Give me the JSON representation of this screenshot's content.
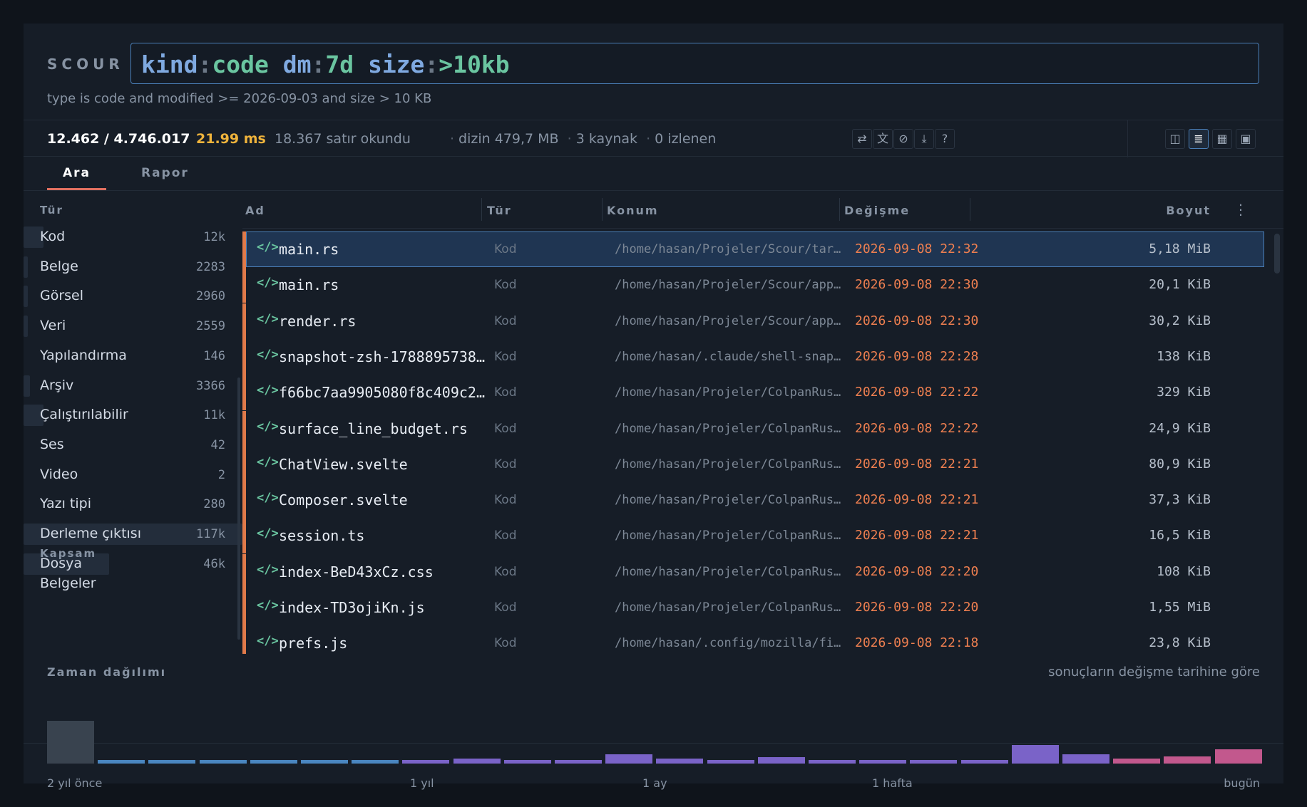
{
  "header": {
    "brand": "SCOUR",
    "query": [
      {
        "t": "kind",
        "c": "key"
      },
      {
        "t": ":",
        "c": "colon"
      },
      {
        "t": "code",
        "c": "val"
      },
      {
        "t": " dm",
        "c": "key"
      },
      {
        "t": ":",
        "c": "colon"
      },
      {
        "t": "7d",
        "c": "val"
      },
      {
        "t": " size",
        "c": "key"
      },
      {
        "t": ":",
        "c": "colon"
      },
      {
        "t": ">10kb",
        "c": "val"
      }
    ],
    "explain": "type is code and modified >= 2026-09-03 and size > 10 KB"
  },
  "stats": {
    "count": "12.462 / 4.746.017",
    "ms": "21.99 ms",
    "rows_read": "18.367 satır okundu",
    "index": "dizin 479,7 MB",
    "sources": "3 kaynak",
    "watched": "0 izlenen"
  },
  "toolbar": {
    "actions": [
      {
        "name": "swap-icon",
        "glyph": "⇄"
      },
      {
        "name": "translate-icon",
        "glyph": "文"
      },
      {
        "name": "block-icon",
        "glyph": "⊘"
      },
      {
        "name": "download-icon",
        "glyph": "⤓"
      },
      {
        "name": "help-icon",
        "glyph": "?"
      }
    ],
    "views": [
      {
        "name": "split-view-icon",
        "glyph": "◫",
        "active": false
      },
      {
        "name": "list-view-icon",
        "glyph": "≣",
        "active": true
      },
      {
        "name": "grid-view-icon",
        "glyph": "▦",
        "active": false
      },
      {
        "name": "preview-view-icon",
        "glyph": "▣",
        "active": false
      }
    ]
  },
  "tabs": {
    "search": "Ara",
    "report": "Rapor"
  },
  "sidebar": {
    "type_heading": "Tür",
    "facets": [
      {
        "label": "Kod",
        "count": "12k",
        "fill": 0.09
      },
      {
        "label": "Belge",
        "count": "2283",
        "fill": 0.02
      },
      {
        "label": "Görsel",
        "count": "2960",
        "fill": 0.02
      },
      {
        "label": "Veri",
        "count": "2559",
        "fill": 0.02
      },
      {
        "label": "Yapılandırma",
        "count": "146",
        "fill": 0.0
      },
      {
        "label": "Arşiv",
        "count": "3366",
        "fill": 0.03
      },
      {
        "label": "Çalıştırılabilir",
        "count": "11k",
        "fill": 0.09
      },
      {
        "label": "Ses",
        "count": "42",
        "fill": 0.0
      },
      {
        "label": "Video",
        "count": "2",
        "fill": 0.0
      },
      {
        "label": "Yazı tipi",
        "count": "280",
        "fill": 0.0
      },
      {
        "label": "Derleme çıktısı",
        "count": "117k",
        "fill": 1.0
      },
      {
        "label": "Dosya",
        "count": "46k",
        "fill": 0.39
      }
    ],
    "scope_heading": "Kapsam",
    "scope_item": "Belgeler"
  },
  "table": {
    "columns": {
      "name": "Ad",
      "type": "Tür",
      "location": "Konum",
      "modified": "Değişme",
      "size": "Boyut"
    },
    "icon_glyph": "</>",
    "rows": [
      {
        "name": "main.rs",
        "type": "Kod",
        "path": "/home/hasan/Projeler/Scour/targ…",
        "date": "2026-09-08 22:32",
        "size": "5,18 MiB"
      },
      {
        "name": "main.rs",
        "type": "Kod",
        "path": "/home/hasan/Projeler/Scour/apps…",
        "date": "2026-09-08 22:30",
        "size": "20,1 KiB"
      },
      {
        "name": "render.rs",
        "type": "Kod",
        "path": "/home/hasan/Projeler/Scour/apps…",
        "date": "2026-09-08 22:30",
        "size": "30,2 KiB"
      },
      {
        "name": "snapshot-zsh-1788895738…",
        "type": "Kod",
        "path": "/home/hasan/.claude/shell-snaps…",
        "date": "2026-09-08 22:28",
        "size": "138 KiB"
      },
      {
        "name": "f66bc7aa9905080f8c409c2…",
        "type": "Kod",
        "path": "/home/hasan/Projeler/ColpanRust…",
        "date": "2026-09-08 22:22",
        "size": "329 KiB"
      },
      {
        "name": "surface_line_budget.rs",
        "type": "Kod",
        "path": "/home/hasan/Projeler/ColpanRust…",
        "date": "2026-09-08 22:22",
        "size": "24,9 KiB"
      },
      {
        "name": "ChatView.svelte",
        "type": "Kod",
        "path": "/home/hasan/Projeler/ColpanRust…",
        "date": "2026-09-08 22:21",
        "size": "80,9 KiB"
      },
      {
        "name": "Composer.svelte",
        "type": "Kod",
        "path": "/home/hasan/Projeler/ColpanRust…",
        "date": "2026-09-08 22:21",
        "size": "37,3 KiB"
      },
      {
        "name": "session.ts",
        "type": "Kod",
        "path": "/home/hasan/Projeler/ColpanRust…",
        "date": "2026-09-08 22:21",
        "size": "16,5 KiB"
      },
      {
        "name": "index-BeD43xCz.css",
        "type": "Kod",
        "path": "/home/hasan/Projeler/ColpanRust…",
        "date": "2026-09-08 22:20",
        "size": "108 KiB"
      },
      {
        "name": "index-TD3ojiKn.js",
        "type": "Kod",
        "path": "/home/hasan/Projeler/ColpanRust…",
        "date": "2026-09-08 22:20",
        "size": "1,55 MiB"
      },
      {
        "name": "prefs.js",
        "type": "Kod",
        "path": "/home/hasan/.config/mozilla/fir…",
        "date": "2026-09-08 22:18",
        "size": "23,8 KiB"
      }
    ]
  },
  "histogram": {
    "title": "Zaman dağılımı",
    "note": "sonuçların değişme tarihine göre",
    "axis_labels": [
      "2 yıl önce",
      "1 yıl",
      "1 ay",
      "1 hafta",
      "bugün"
    ],
    "bars": [
      {
        "v": 1.0,
        "color": "#39434f"
      },
      {
        "v": 0.08,
        "color": "#4a86c0"
      },
      {
        "v": 0.08,
        "color": "#4a86c0"
      },
      {
        "v": 0.08,
        "color": "#4a86c0"
      },
      {
        "v": 0.08,
        "color": "#4a86c0"
      },
      {
        "v": 0.08,
        "color": "#4a86c0"
      },
      {
        "v": 0.08,
        "color": "#4a86c0"
      },
      {
        "v": 0.09,
        "color": "#7a63c8"
      },
      {
        "v": 0.12,
        "color": "#7a63c8"
      },
      {
        "v": 0.09,
        "color": "#7a63c8"
      },
      {
        "v": 0.09,
        "color": "#7a63c8"
      },
      {
        "v": 0.22,
        "color": "#7a63c8"
      },
      {
        "v": 0.12,
        "color": "#7a63c8"
      },
      {
        "v": 0.09,
        "color": "#7a63c8"
      },
      {
        "v": 0.15,
        "color": "#7a63c8"
      },
      {
        "v": 0.09,
        "color": "#7a63c8"
      },
      {
        "v": 0.09,
        "color": "#7a63c8"
      },
      {
        "v": 0.09,
        "color": "#7a63c8"
      },
      {
        "v": 0.09,
        "color": "#7a63c8"
      },
      {
        "v": 0.44,
        "color": "#7a63c8"
      },
      {
        "v": 0.21,
        "color": "#7a63c8"
      },
      {
        "v": 0.12,
        "color": "#c2588d"
      },
      {
        "v": 0.16,
        "color": "#c2588d"
      },
      {
        "v": 0.33,
        "color": "#c2588d"
      }
    ]
  }
}
